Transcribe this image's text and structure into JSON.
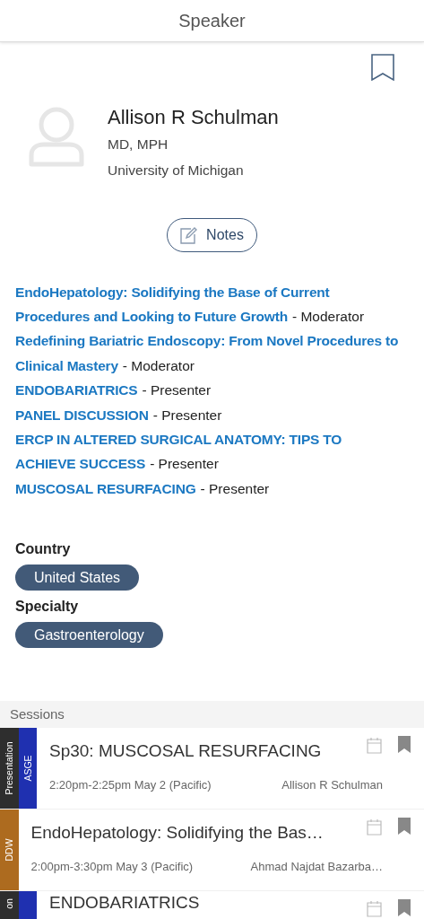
{
  "header": {
    "title": "Speaker"
  },
  "speaker": {
    "name": "Allison R Schulman",
    "credentials": "MD, MPH",
    "affiliation": "University of Michigan",
    "notes_button": "Notes"
  },
  "roles": [
    {
      "lines": [
        "EndoHepatology: Solidifying the Base of Current",
        "Procedures and Looking to Future Growth"
      ],
      "role": "- Moderator"
    },
    {
      "lines": [
        "Redefining Bariatric Endoscopy: From Novel Procedures to",
        "Clinical Mastery"
      ],
      "role": "- Moderator"
    },
    {
      "lines": [
        "ENDOBARIATRICS"
      ],
      "role": "- Presenter"
    },
    {
      "lines": [
        "PANEL DISCUSSION"
      ],
      "role": "- Presenter"
    },
    {
      "lines": [
        "ERCP IN ALTERED SURGICAL ANATOMY: TIPS TO",
        "ACHIEVE SUCCESS"
      ],
      "role": "- Presenter"
    },
    {
      "lines": [
        "MUSCOSAL RESURFACING"
      ],
      "role": "- Presenter"
    }
  ],
  "attributes": [
    {
      "label": "Country",
      "values": [
        "United States"
      ]
    },
    {
      "label": "Specialty",
      "values": [
        "Gastroenterology"
      ]
    }
  ],
  "sessions": {
    "heading": "Sessions",
    "items": [
      {
        "tags": [
          {
            "label": "Presentation",
            "color": "#2e2e2e"
          },
          {
            "label": "ASGE",
            "color": "#1f30b0"
          }
        ],
        "title": "Sp30: MUSCOSAL RESURFACING",
        "time": "2:20pm-2:25pm May 2 (Pacific)",
        "speaker": "Allison R Schulman"
      },
      {
        "tags": [
          {
            "label": "DDW",
            "color": "#ad6b1f"
          }
        ],
        "title": "EndoHepatology: Solidifying the Bas…",
        "time": "2:00pm-3:30pm May 3 (Pacific)",
        "speaker": "Ahmad Najdat Bazarba…"
      },
      {
        "tags": [
          {
            "label": "on",
            "color": "#2e2e2e"
          },
          {
            "color": "#1f30b0"
          }
        ],
        "title": "ENDOBARIATRICS"
      }
    ]
  }
}
